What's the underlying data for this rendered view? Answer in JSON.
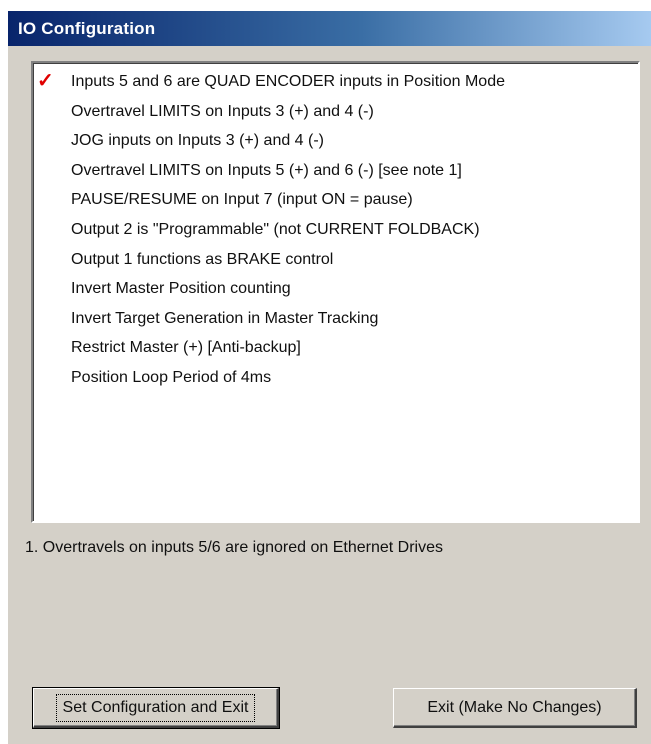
{
  "window": {
    "title": "IO Configuration"
  },
  "options": [
    {
      "label": "Inputs 5 and 6 are QUAD ENCODER inputs in Position Mode",
      "checked": true
    },
    {
      "label": "Overtravel LIMITS on Inputs 3 (+) and 4 (-)",
      "checked": false
    },
    {
      "label": "JOG inputs on Inputs 3 (+) and 4 (-)",
      "checked": false
    },
    {
      "label": "Overtravel LIMITS on Inputs 5 (+) and 6 (-)   [see note 1]",
      "checked": false
    },
    {
      "label": "PAUSE/RESUME on Input 7 (input ON = pause)",
      "checked": false
    },
    {
      "label": "Output 2 is \"Programmable\" (not CURRENT FOLDBACK)",
      "checked": false
    },
    {
      "label": "Output 1 functions as BRAKE control",
      "checked": false
    },
    {
      "label": "Invert Master Position counting",
      "checked": false
    },
    {
      "label": "Invert Target Generation in Master Tracking",
      "checked": false
    },
    {
      "label": "Restrict Master (+) [Anti-backup]",
      "checked": false
    },
    {
      "label": "Position Loop Period of 4ms",
      "checked": false
    }
  ],
  "check_mark": {
    "glyph": "✓",
    "color": "#e00000",
    "icon": "checkmark-icon"
  },
  "note": "1. Overtravels on inputs 5/6 are ignored on Ethernet Drives",
  "buttons": {
    "set": "Set Configuration and Exit",
    "exit": "Exit (Make No Changes)"
  }
}
